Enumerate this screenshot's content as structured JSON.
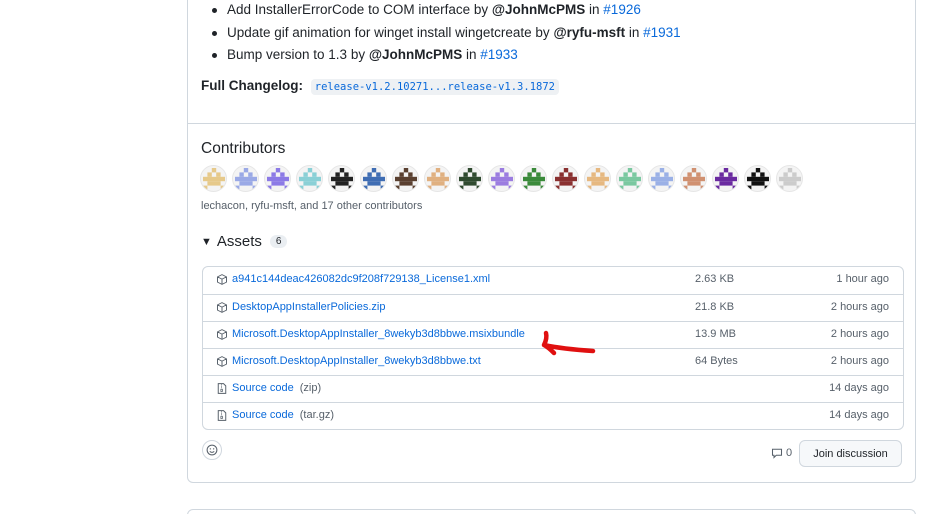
{
  "notes": [
    {
      "text": "Add InstallerErrorCode to COM interface by ",
      "user": "@JohnMcPMS",
      "in": " in ",
      "pr": "#1926"
    },
    {
      "text": "Update gif animation for winget install wingetcreate by ",
      "user": "@ryfu-msft",
      "in": " in ",
      "pr": "#1931"
    },
    {
      "text": "Bump version to 1.3 by ",
      "user": "@JohnMcPMS",
      "in": " in ",
      "pr": "#1933"
    }
  ],
  "changelog": {
    "label": "Full Changelog:",
    "range": "release-v1.2.10271...release-v1.3.1872"
  },
  "contributors": {
    "title": "Contributors",
    "summary": "lechacon, ryfu-msft, and 17 other contributors",
    "avatar_colors": [
      "#e6c98a",
      "#9aa9e6",
      "#8c7ae6",
      "#8ad0d6",
      "#222222",
      "#3f6db3",
      "#5a4030",
      "#e0b080",
      "#2f4a2f",
      "#9b7ce0",
      "#3a8a3a",
      "#8a3030",
      "#e6b880",
      "#7ac8a0",
      "#9ab0e6",
      "#d09070",
      "#6a2aa0",
      "#111111",
      "#cccccc"
    ]
  },
  "assets": {
    "title": "Assets",
    "count": "6",
    "items": [
      {
        "name": "a941c144deac426082dc9f208f729138_License1.xml",
        "ext": "",
        "size": "2.63 KB",
        "time": "1 hour ago",
        "icon": "package-icon"
      },
      {
        "name": "DesktopAppInstallerPolicies.zip",
        "ext": "",
        "size": "21.8 KB",
        "time": "2 hours ago",
        "icon": "package-icon"
      },
      {
        "name": "Microsoft.DesktopAppInstaller_8wekyb3d8bbwe.msixbundle",
        "ext": "",
        "size": "13.9 MB",
        "time": "2 hours ago",
        "icon": "package-icon"
      },
      {
        "name": "Microsoft.DesktopAppInstaller_8wekyb3d8bbwe.txt",
        "ext": "",
        "size": "64 Bytes",
        "time": "2 hours ago",
        "icon": "package-icon"
      },
      {
        "name": "Source code",
        "ext": "(zip)",
        "size": "",
        "time": "14 days ago",
        "icon": "file-zip-icon"
      },
      {
        "name": "Source code",
        "ext": "(tar.gz)",
        "size": "",
        "time": "14 days ago",
        "icon": "file-zip-icon"
      }
    ]
  },
  "footer": {
    "comment_count": "0",
    "join_label": "Join discussion"
  },
  "colors": {
    "link": "#0969da",
    "border": "#d0d7de",
    "annotation": "#e01010"
  }
}
